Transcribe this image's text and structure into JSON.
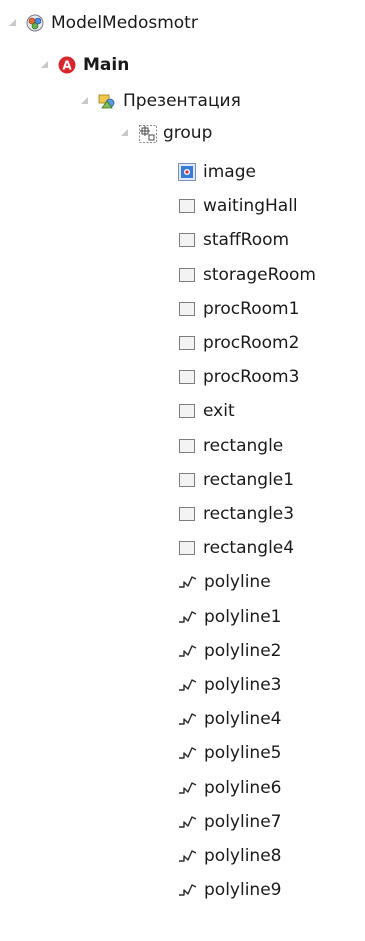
{
  "tree": {
    "root": {
      "label": "ModelMedosmotr",
      "icon": "model-icon"
    },
    "main": {
      "label": "Main",
      "icon": "agent-class-icon"
    },
    "presentation": {
      "label": "Презентация",
      "icon": "presentation-icon"
    },
    "group": {
      "label": "group",
      "icon": "group-icon"
    },
    "children": [
      {
        "label": "image",
        "icon": "image-icon"
      },
      {
        "label": "waitingHall",
        "icon": "rectangle-icon"
      },
      {
        "label": "staffRoom",
        "icon": "rectangle-icon"
      },
      {
        "label": "storageRoom",
        "icon": "rectangle-icon"
      },
      {
        "label": "procRoom1",
        "icon": "rectangle-icon"
      },
      {
        "label": "procRoom2",
        "icon": "rectangle-icon"
      },
      {
        "label": "procRoom3",
        "icon": "rectangle-icon"
      },
      {
        "label": "exit",
        "icon": "rectangle-icon"
      },
      {
        "label": "rectangle",
        "icon": "rectangle-icon"
      },
      {
        "label": "rectangle1",
        "icon": "rectangle-icon"
      },
      {
        "label": "rectangle3",
        "icon": "rectangle-icon"
      },
      {
        "label": "rectangle4",
        "icon": "rectangle-icon"
      },
      {
        "label": "polyline",
        "icon": "polyline-icon"
      },
      {
        "label": "polyline1",
        "icon": "polyline-icon"
      },
      {
        "label": "polyline2",
        "icon": "polyline-icon"
      },
      {
        "label": "polyline3",
        "icon": "polyline-icon"
      },
      {
        "label": "polyline4",
        "icon": "polyline-icon"
      },
      {
        "label": "polyline5",
        "icon": "polyline-icon"
      },
      {
        "label": "polyline6",
        "icon": "polyline-icon"
      },
      {
        "label": "polyline7",
        "icon": "polyline-icon"
      },
      {
        "label": "polyline8",
        "icon": "polyline-icon"
      },
      {
        "label": "polyline9",
        "icon": "polyline-icon"
      }
    ]
  },
  "colors": {
    "agent_badge": "#d7262e",
    "image_badge": "#3a7bd5",
    "text": "#1a1a1a"
  }
}
